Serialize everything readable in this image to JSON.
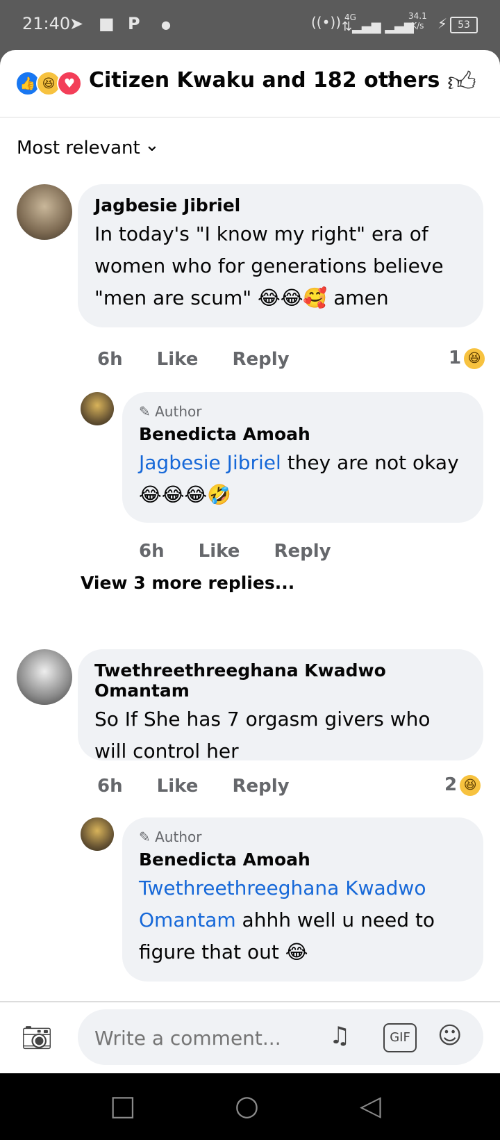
{
  "status_bar": {
    "time": "21:40",
    "net_speed_top": "34.1",
    "net_speed_bottom": "K/s",
    "network": "4G",
    "battery": "53"
  },
  "header": {
    "reactions_text": "Citizen Kwaku and 182 others"
  },
  "sort": {
    "label": "Most relevant"
  },
  "comments": [
    {
      "name": "Jagbesie Jibriel",
      "text": "In today's \"I know my right\" era of women who for generations believe \"men are scum\" 😂😂🥰 amen",
      "time": "6h",
      "like": "Like",
      "reply": "Reply",
      "reaction_count": "1",
      "replies": [
        {
          "author_tag": "Author",
          "name": "Benedicta Amoah",
          "mention": "Jagbesie Jibriel",
          "text": " they are not okay 😂😂😂🤣",
          "time": "6h",
          "like": "Like",
          "reply": "Reply"
        }
      ]
    },
    {
      "name": "Twethreethreeghana Kwadwo Omantam",
      "text": "So If She has 7 orgasm givers who will control her",
      "time": "6h",
      "like": "Like",
      "reply": "Reply",
      "reaction_count": "2",
      "replies": [
        {
          "author_tag": "Author",
          "name": "Benedicta Amoah",
          "mention": "Twethreethreeghana Kwadwo Omantam",
          "text": " ahhh well u need to figure that out 😂"
        }
      ]
    }
  ],
  "view_more": "View 3 more replies...",
  "composer": {
    "placeholder": "Write a comment..."
  }
}
